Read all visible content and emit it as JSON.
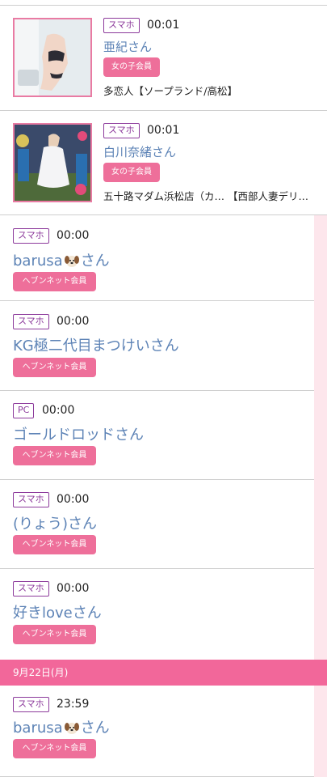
{
  "entries": [
    {
      "device": "スマホ",
      "time": "00:01",
      "name": "亜紀さん",
      "member": "女の子会員",
      "shop": "多恋人【ソープランド/高松】"
    },
    {
      "device": "スマホ",
      "time": "00:01",
      "name": "白川奈緒さん",
      "member": "女の子会員",
      "shop": "五十路マダム浜松店（カ… 【西部人妻デリ…"
    },
    {
      "device": "スマホ",
      "time": "00:00",
      "name_pre": "barusa",
      "name_post": "さん",
      "member": "ヘブンネット会員"
    },
    {
      "device": "スマホ",
      "time": "00:00",
      "name": "KG極二代目まつけいさん",
      "member": "ヘブンネット会員"
    },
    {
      "device": "PC",
      "time": "00:00",
      "name": "ゴールドロッドさん",
      "member": "ヘブンネット会員"
    },
    {
      "device": "スマホ",
      "time": "00:00",
      "name": "(りょう)さん",
      "member": "ヘブンネット会員"
    },
    {
      "device": "スマホ",
      "time": "00:00",
      "name": "好きloveさん",
      "member": "ヘブンネット会員"
    },
    {
      "device": "スマホ",
      "time": "23:59",
      "name_pre": "barusa",
      "name_post": "さん",
      "member": "ヘブンネット会員"
    }
  ],
  "date_header": "9月22日(月)",
  "icons": {
    "thumb1": "woman-photo-icon",
    "thumb2": "woman-photo-icon",
    "dog": "dog-emoji-icon"
  },
  "colors": {
    "accent": "#ee6f9a",
    "device_border": "#8d3b9c",
    "name": "#5d83b6",
    "sidebar": "#fde6ec",
    "date_bar": "#f2679a"
  }
}
